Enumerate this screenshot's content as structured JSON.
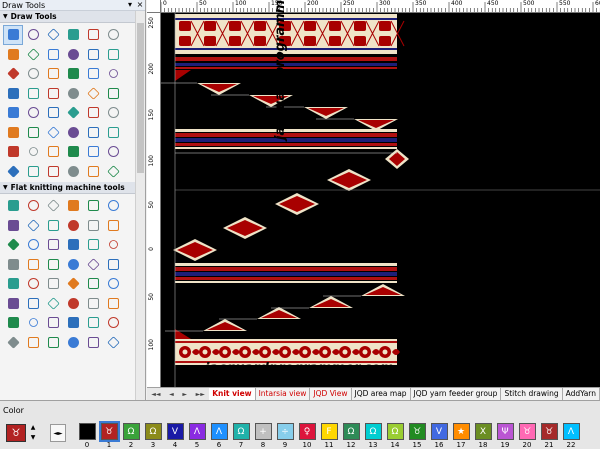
{
  "panel": {
    "title": "Draw Tools",
    "pin_icon": "pin-icon",
    "close_icon": "close-icon",
    "sections": {
      "draw": "Draw Tools",
      "flat": "Flat knitting machine tools"
    },
    "draw_tools_count": 48,
    "flat_tools_count": 48
  },
  "ruler": {
    "top_labels": [
      "0",
      "50",
      "100",
      "150",
      "200",
      "250",
      "300",
      "350",
      "400",
      "450",
      "500",
      "550",
      "600"
    ],
    "left_labels": [
      "250",
      "200",
      "150",
      "100",
      "50",
      "0",
      "50",
      "100"
    ]
  },
  "watermark": {
    "vertical": "jacquardprogrammer.com",
    "horizontal": "jacquardprogrammer.com"
  },
  "tabs": {
    "nav": [
      "◄◄",
      "◄",
      "►",
      "►►"
    ],
    "items": [
      {
        "label": "Knit view",
        "style": "red active"
      },
      {
        "label": "Intarsia view",
        "style": "red"
      },
      {
        "label": "JQD View",
        "style": "red"
      },
      {
        "label": "JQD area map",
        "style": ""
      },
      {
        "label": "JQD yarn feeder group",
        "style": ""
      },
      {
        "label": "Stitch drawing",
        "style": ""
      },
      {
        "label": "AddYarn",
        "style": ""
      }
    ]
  },
  "color_panel": {
    "title": "Color",
    "current_symbol": "♉",
    "swatches": [
      {
        "n": "0",
        "color": "#000000",
        "sym": ""
      },
      {
        "n": "1",
        "color": "#b22222",
        "sym": "♉"
      },
      {
        "n": "2",
        "color": "#3aa33a",
        "sym": "Ω"
      },
      {
        "n": "3",
        "color": "#8b8b1a",
        "sym": "Ω"
      },
      {
        "n": "4",
        "color": "#1a1aa6",
        "sym": "V"
      },
      {
        "n": "5",
        "color": "#8a2be2",
        "sym": "Λ"
      },
      {
        "n": "6",
        "color": "#1e90ff",
        "sym": "Λ"
      },
      {
        "n": "7",
        "color": "#20b2aa",
        "sym": "Ω"
      },
      {
        "n": "8",
        "color": "#c0c0c0",
        "sym": "+"
      },
      {
        "n": "9",
        "color": "#87ceeb",
        "sym": "÷"
      },
      {
        "n": "10",
        "color": "#dc143c",
        "sym": "♀"
      },
      {
        "n": "11",
        "color": "#ffd700",
        "sym": "F"
      },
      {
        "n": "12",
        "color": "#2e8b57",
        "sym": "Ω"
      },
      {
        "n": "13",
        "color": "#00ced1",
        "sym": "Ω"
      },
      {
        "n": "14",
        "color": "#9acd32",
        "sym": "Ω"
      },
      {
        "n": "15",
        "color": "#228b22",
        "sym": "♉"
      },
      {
        "n": "16",
        "color": "#4169e1",
        "sym": "V"
      },
      {
        "n": "17",
        "color": "#ff8c00",
        "sym": "★"
      },
      {
        "n": "18",
        "color": "#6b8e23",
        "sym": "X"
      },
      {
        "n": "19",
        "color": "#ba55d3",
        "sym": "Ψ"
      },
      {
        "n": "20",
        "color": "#ff69b4",
        "sym": "♉"
      },
      {
        "n": "21",
        "color": "#a52a2a",
        "sym": "♉"
      },
      {
        "n": "22",
        "color": "#00bfff",
        "sym": "Λ"
      }
    ]
  },
  "colors": {
    "fabric_bg": "#000000",
    "motif_red": "#a80000",
    "motif_cream": "#efe3c7",
    "stripe_red": "#b01010",
    "stripe_navy": "#1c1f78"
  }
}
